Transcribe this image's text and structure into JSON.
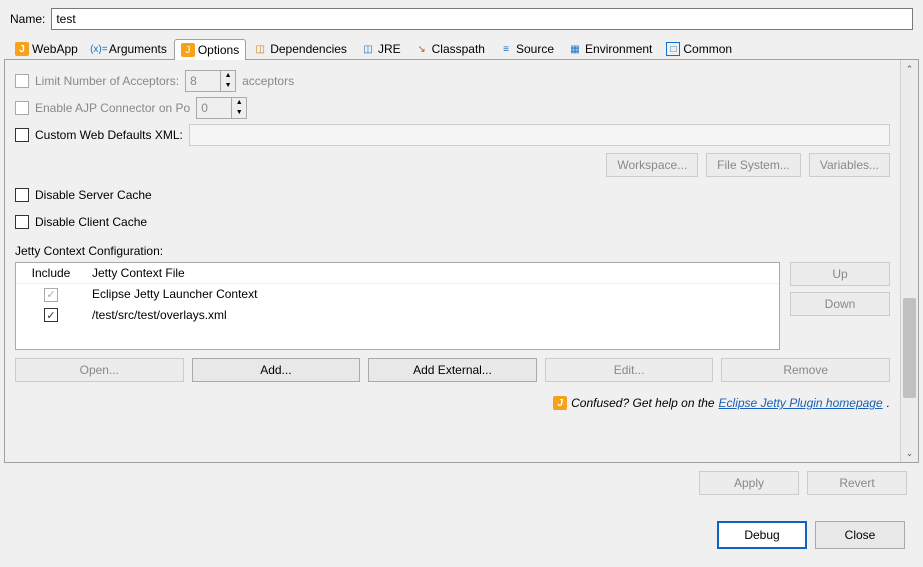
{
  "name": {
    "label": "Name:",
    "value": "test"
  },
  "tabs": {
    "webapp": "WebApp",
    "arguments": "Arguments",
    "options": "Options",
    "dependencies": "Dependencies",
    "jre": "JRE",
    "classpath": "Classpath",
    "source": "Source",
    "environment": "Environment",
    "common": "Common"
  },
  "options": {
    "limit_acceptors_label": "Limit Number of Acceptors:",
    "limit_acceptors_value": "8",
    "acceptors_suffix": "acceptors",
    "enable_ajp_label": "Enable AJP Connector on Po",
    "enable_ajp_value": "0",
    "custom_defaults_label": "Custom Web Defaults XML:",
    "workspace_btn": "Workspace...",
    "filesystem_btn": "File System...",
    "variables_btn": "Variables...",
    "disable_server_cache": "Disable Server Cache",
    "disable_client_cache": "Disable Client Cache",
    "jetty_ctx_label": "Jetty Context Configuration:",
    "col_include": "Include",
    "col_file": "Jetty Context File",
    "rows": [
      {
        "file": "Eclipse Jetty Launcher Context",
        "checked": true,
        "locked": true
      },
      {
        "file": "/test/src/test/overlays.xml",
        "checked": true,
        "locked": false
      }
    ],
    "up_btn": "Up",
    "down_btn": "Down",
    "open_btn": "Open...",
    "add_btn": "Add...",
    "add_ext_btn": "Add External...",
    "edit_btn": "Edit...",
    "remove_btn": "Remove",
    "help_prefix": "Confused? Get help on the ",
    "help_link": "Eclipse Jetty Plugin homepage",
    "help_suffix": "."
  },
  "footer": {
    "apply": "Apply",
    "revert": "Revert",
    "debug": "Debug",
    "close": "Close"
  }
}
